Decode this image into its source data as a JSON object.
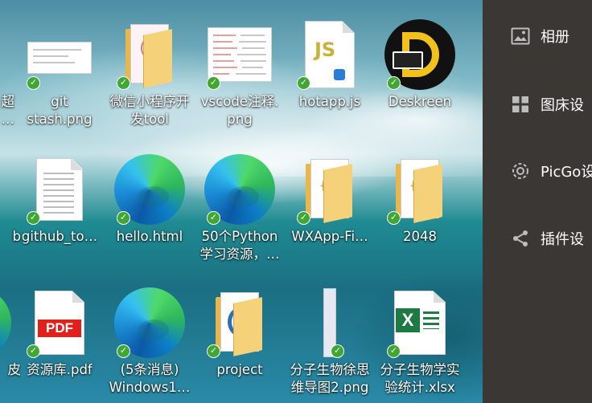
{
  "desktop": {
    "icons": [
      {
        "label": "超\n…",
        "type": "partial"
      },
      {
        "label": "git\nstash.png",
        "type": "image"
      },
      {
        "label": "微信小程序开\n发tool",
        "type": "folder"
      },
      {
        "label": "vscode注释.\npng",
        "type": "image"
      },
      {
        "label": "hotapp.js",
        "type": "js"
      },
      {
        "label": "Deskreen",
        "type": "app"
      },
      {
        "label": "b",
        "type": "partial"
      },
      {
        "label": "github_to…",
        "type": "text"
      },
      {
        "label": "hello.html",
        "type": "edge"
      },
      {
        "label": "50个Python\n学习资源，…",
        "type": "edge"
      },
      {
        "label": "WXApp-Fi…",
        "type": "folder"
      },
      {
        "label": "2048",
        "type": "folder"
      },
      {
        "label": "皮",
        "type": "partial"
      },
      {
        "label": "资源库.pdf",
        "type": "pdf"
      },
      {
        "label": "(5条消息)\nWindows1…",
        "type": "edge"
      },
      {
        "label": "project",
        "type": "folder"
      },
      {
        "label": "分子生物徐思\n维导图2.png",
        "type": "image"
      },
      {
        "label": "分子生物学实\n验统计.xlsx",
        "type": "excel"
      }
    ],
    "pdf_badge": "PDF",
    "js_badge": "JS",
    "xlsx_badge": "X",
    "sync_color": "#3ea832"
  },
  "panel": {
    "items": [
      {
        "label": "相册",
        "icon": "image-icon"
      },
      {
        "label": "图床设",
        "icon": "grid-icon"
      },
      {
        "label": "PicGo设",
        "icon": "gear-icon"
      },
      {
        "label": "插件设",
        "icon": "share-icon"
      }
    ],
    "background": "#3b3734"
  }
}
